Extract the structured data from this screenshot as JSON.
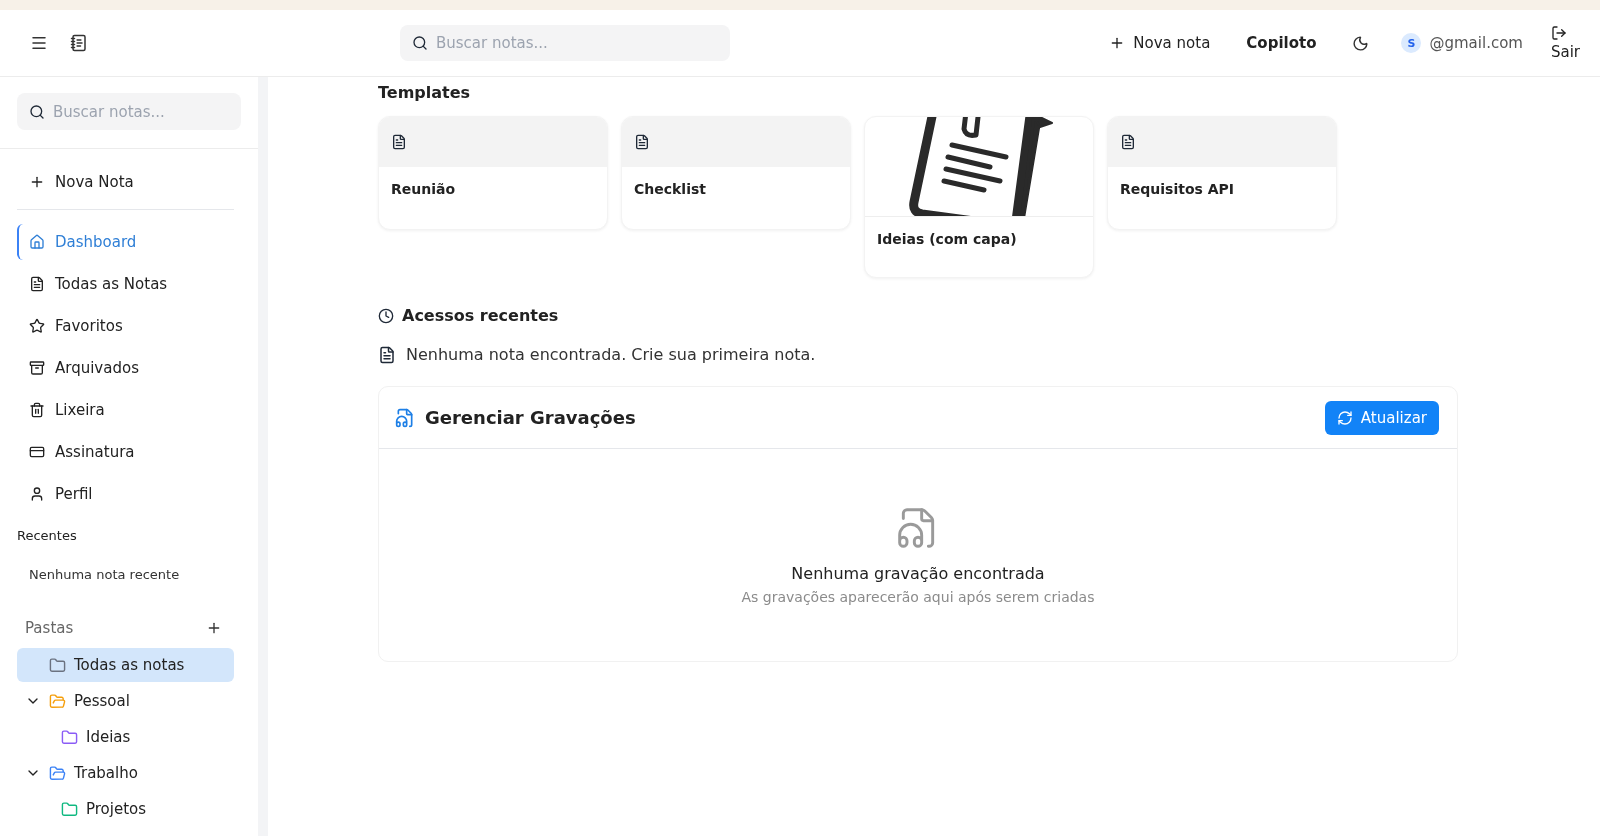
{
  "header": {
    "search_placeholder": "Buscar notas...",
    "new_note": "Nova nota",
    "copilot": "Copiloto",
    "avatar_initial": "S",
    "email": "@gmail.com",
    "logout": "Sair"
  },
  "sidebar": {
    "search_placeholder": "Buscar notas...",
    "new_note": "Nova Nota",
    "nav": [
      {
        "label": "Dashboard",
        "kind": "home",
        "selected": true
      },
      {
        "label": "Todas as Notas",
        "kind": "notes",
        "selected": false
      },
      {
        "label": "Favoritos",
        "kind": "star",
        "selected": false
      },
      {
        "label": "Arquivados",
        "kind": "archive",
        "selected": false
      },
      {
        "label": "Lixeira",
        "kind": "trash",
        "selected": false
      },
      {
        "label": "Assinatura",
        "kind": "card",
        "selected": false
      },
      {
        "label": "Perfil",
        "kind": "user",
        "selected": false
      }
    ],
    "recents_title": "Recentes",
    "recents_empty": "Nenhuma nota recente",
    "folders_title": "Pastas",
    "folders": [
      {
        "label": "Todas as notas",
        "color": "#6b7280",
        "selected": true
      },
      {
        "label": "Pessoal",
        "color": "#f59e0b",
        "selected": false,
        "expanded": true,
        "children": [
          {
            "label": "Ideias",
            "color": "#8b5cf6",
            "selected": false
          }
        ]
      },
      {
        "label": "Trabalho",
        "color": "#3b82f6",
        "selected": false,
        "expanded": true,
        "children": [
          {
            "label": "Projetos",
            "color": "#10b981",
            "selected": false
          }
        ]
      }
    ]
  },
  "templates": {
    "title": "Templates",
    "items": [
      {
        "title": "Reunião",
        "kind": "plain"
      },
      {
        "title": "Checklist",
        "kind": "plain"
      },
      {
        "title": "Ideias (com capa)",
        "kind": "cover"
      },
      {
        "title": "Requisitos API",
        "kind": "plain"
      }
    ]
  },
  "recent_access": {
    "title": "Acessos recentes",
    "empty": "Nenhuma nota encontrada. Crie sua primeira nota."
  },
  "recordings": {
    "title": "Gerenciar Gravações",
    "button": "Atualizar",
    "empty_title": "Nenhuma gravação encontrada",
    "empty_subtitle": "As gravações aparecerão aqui após serem criadas"
  }
}
